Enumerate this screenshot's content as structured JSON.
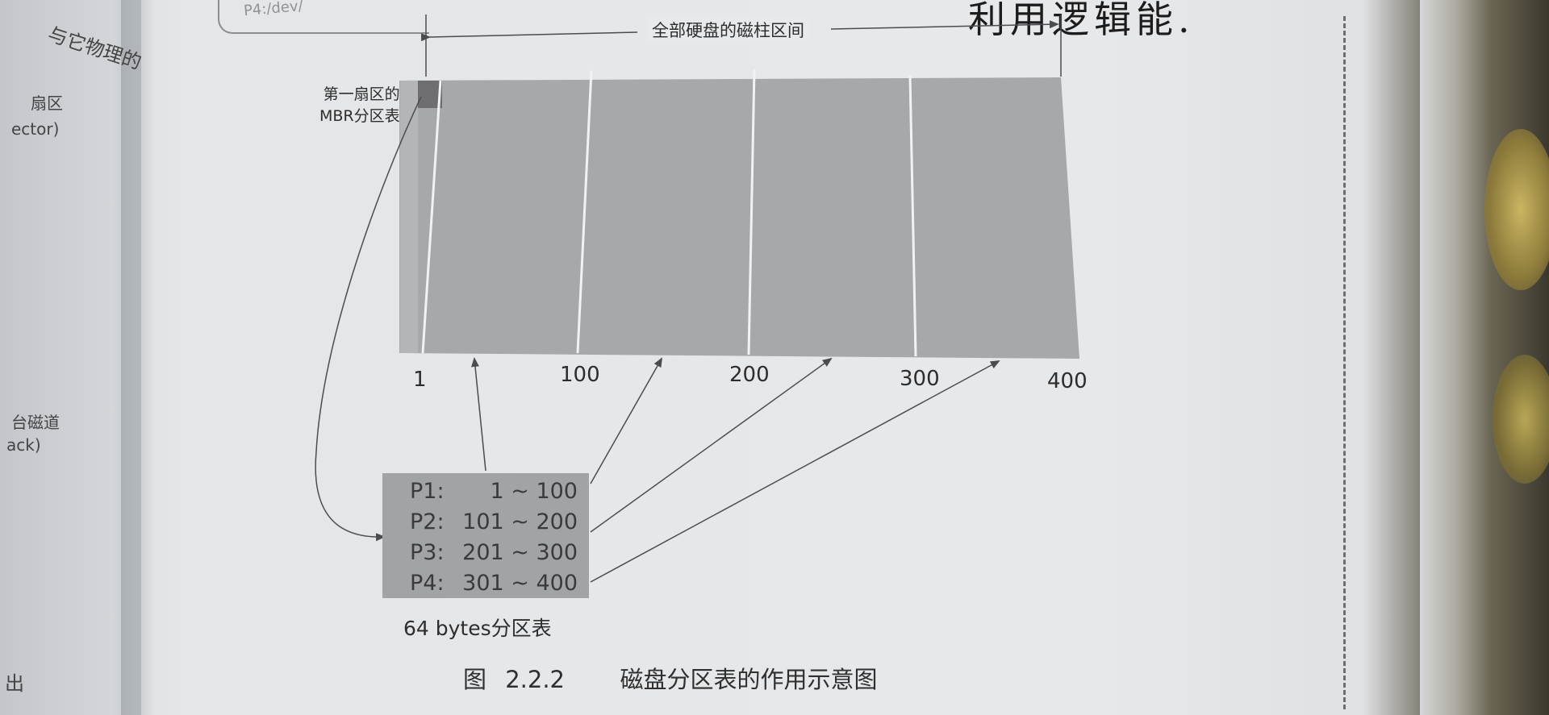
{
  "left_page": {
    "fragments": [
      "与它物理的",
      "扇区",
      "ector)",
      "台磁道",
      "ack)",
      "出"
    ]
  },
  "header": {
    "cut_label": "P4:/dev/",
    "handwritten_note": "利用逻辑能."
  },
  "diagram": {
    "span_label": "全部硬盘的磁柱区间",
    "mbr_label_line1": "第一扇区的",
    "mbr_label_line2": "MBR分区表",
    "axis_ticks": [
      {
        "value": 1,
        "label": "1"
      },
      {
        "value": 100,
        "label": "100"
      },
      {
        "value": 200,
        "label": "200"
      },
      {
        "value": 300,
        "label": "300"
      },
      {
        "value": 400,
        "label": "400"
      }
    ],
    "partitions": [
      {
        "name": "P1:",
        "start": 1,
        "end": 100,
        "range": "1 ~ 100"
      },
      {
        "name": "P2:",
        "start": 101,
        "end": 200,
        "range": "101 ~ 200"
      },
      {
        "name": "P3:",
        "start": 201,
        "end": 300,
        "range": "201 ~ 300"
      },
      {
        "name": "P4:",
        "start": 301,
        "end": 400,
        "range": "301 ~ 400"
      }
    ],
    "table_label": "64 bytes分区表",
    "colors": {
      "disk": "#a6a8ab",
      "mbr_cell": "#6e6e70",
      "partition_table": "#a1a3a6",
      "lines": "#4a4c4f"
    }
  },
  "caption": {
    "figure_number": "图 2.2.2",
    "title": "磁盘分区表的作用示意图"
  }
}
